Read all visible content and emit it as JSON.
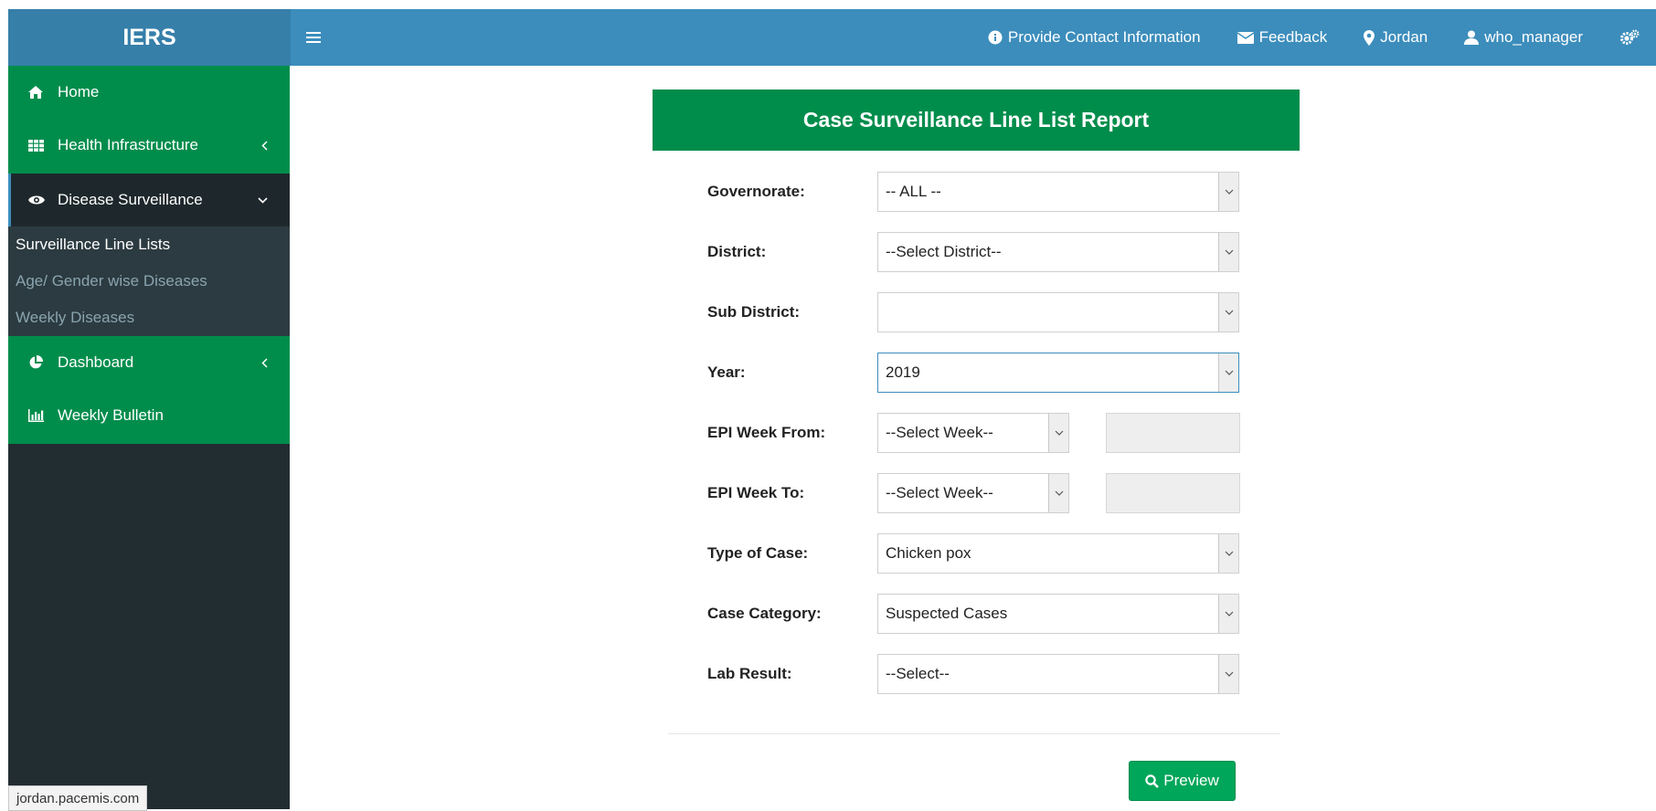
{
  "header": {
    "logo": "IERS",
    "menu_toggle_icon": "hamburger-icon",
    "nav": {
      "contact": "Provide Contact Information",
      "feedback": "Feedback",
      "location": "Jordan",
      "user": "who_manager"
    }
  },
  "sidebar": {
    "items": [
      {
        "label": "Home",
        "icon": "home-icon"
      },
      {
        "label": "Health Infrastructure",
        "icon": "grid-icon"
      },
      {
        "label": "Disease Surveillance",
        "icon": "eye-icon"
      },
      {
        "label": "Dashboard",
        "icon": "pie-chart-icon"
      },
      {
        "label": "Weekly Bulletin",
        "icon": "bar-chart-icon"
      }
    ],
    "subitems": [
      {
        "label": "Surveillance Line Lists",
        "active": true
      },
      {
        "label": "Age/ Gender wise Diseases"
      },
      {
        "label": "Weekly Diseases"
      }
    ]
  },
  "report": {
    "title": "Case Surveillance Line List Report",
    "fields": {
      "governorate": {
        "label": "Governorate:",
        "value": "-- ALL --"
      },
      "district": {
        "label": "District:",
        "value": "--Select District--"
      },
      "sub_district": {
        "label": "Sub District:",
        "value": ""
      },
      "year": {
        "label": "Year:",
        "value": "2019"
      },
      "epi_week_from": {
        "label": "EPI Week From:",
        "value": "--Select Week--"
      },
      "epi_week_to": {
        "label": "EPI Week To:",
        "value": "--Select Week--"
      },
      "type_of_case": {
        "label": "Type of Case:",
        "value": "Chicken pox"
      },
      "case_category": {
        "label": "Case Category:",
        "value": "Suspected Cases"
      },
      "lab_result": {
        "label": "Lab Result:",
        "value": "--Select--"
      }
    },
    "preview_button": "Preview"
  },
  "status_tooltip": "jordan.pacemis.com",
  "colors": {
    "topbar": "#3c8dbc",
    "logo_bg": "#367fa9",
    "sidebar_green": "#008d4c",
    "sidebar_dark": "#222d32",
    "button_green": "#00a65a"
  }
}
